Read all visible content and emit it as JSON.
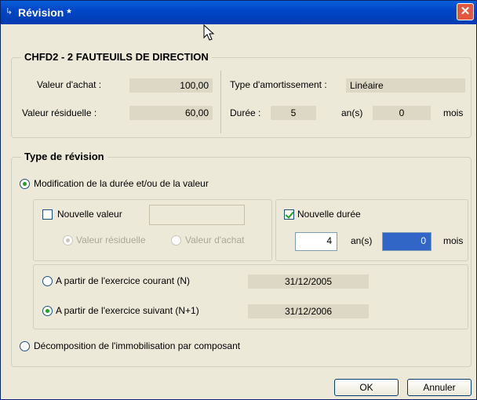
{
  "window": {
    "title": "Révision *",
    "close_label": "✕",
    "app_icon": "↳"
  },
  "asset": {
    "group_title": "CHFD2 - 2 FAUTEUILS DE DIRECTION",
    "purchase_label": "Valeur d'achat :",
    "purchase_value": "100,00",
    "residual_label": "Valeur résiduelle :",
    "residual_value": "60,00",
    "amort_type_label": "Type d'amortissement :",
    "amort_type_value": "Linéaire",
    "duration_label": "Durée :",
    "duration_years": "5",
    "years_unit": "an(s)",
    "duration_months": "0",
    "months_unit": "mois"
  },
  "revision": {
    "group_title": "Type de révision",
    "option_modify_label": "Modification de la durée et/ou de la valeur",
    "new_value_label": "Nouvelle valeur",
    "new_value_input": "",
    "residual_radio_label": "Valeur résiduelle",
    "purchase_radio_label": "Valeur d'achat",
    "new_duration_label": "Nouvelle durée",
    "new_years": "4",
    "new_years_unit": "an(s)",
    "new_months": "0",
    "new_months_unit": "mois",
    "from_current_label": "A partir de l'exercice courant (N)",
    "from_current_date": "31/12/2005",
    "from_next_label": "A partir de l'exercice suivant (N+1)",
    "from_next_date": "31/12/2006",
    "option_decompose_label": "Décomposition de l'immobilisation par composant"
  },
  "buttons": {
    "ok": "OK",
    "cancel": "Annuler"
  },
  "state": {
    "option_modify_selected": true,
    "new_value_checked": false,
    "residual_radio_selected": true,
    "new_duration_checked": true,
    "from_next_selected": true
  }
}
